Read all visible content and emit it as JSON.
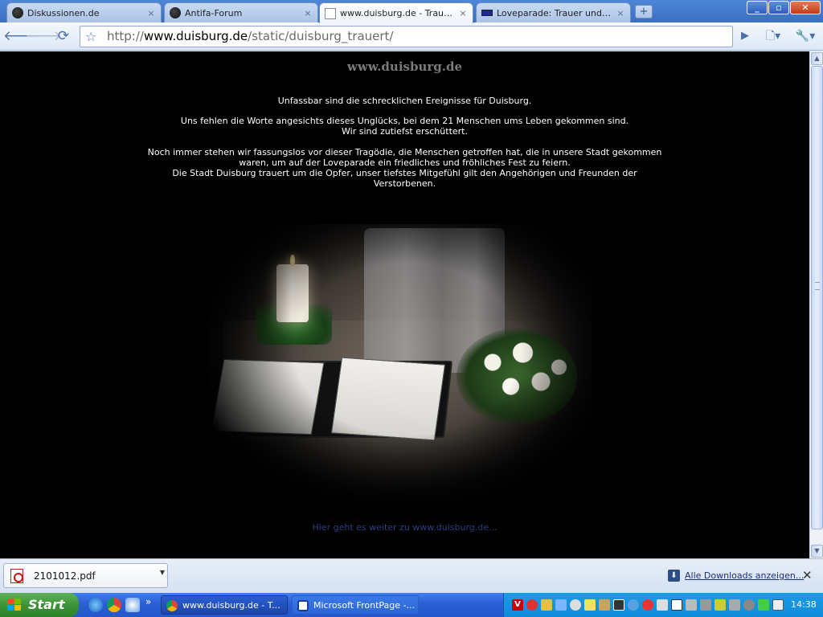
{
  "browser": {
    "tabs": [
      {
        "title": "Diskussionen.de",
        "icon": "bird-icon"
      },
      {
        "title": "Antifa-Forum",
        "icon": "bird-icon"
      },
      {
        "title": "www.duisburg.de - Trauer ...",
        "icon": "page-icon",
        "active": true
      },
      {
        "title": "Loveparade: Trauer und V...",
        "icon": "flag-icon"
      }
    ],
    "close_glyph": "×",
    "new_tab_glyph": "+",
    "url": {
      "scheme": "http://",
      "host": "www.duisburg.de",
      "path": "/static/duisburg_trauert/"
    }
  },
  "page": {
    "site_title": "www.duisburg.de",
    "message": {
      "line1": "Unfassbar sind die schrecklichen Ereignisse für Duisburg.",
      "line2": "Uns fehlen die Worte angesichts dieses Unglücks, bei dem 21 Menschen ums Leben gekommen sind.",
      "line3": "Wir sind zutiefst erschüttert.",
      "line4": "Noch immer stehen wir fassungslos vor dieser Tragödie, die Menschen getroffen hat, die in unsere Stadt gekommen waren, um auf der Loveparade ein friedliches und fröhliches Fest zu feiern.",
      "line5": "Die Stadt Duisburg trauert um die Opfer, unser tiefstes Mitgefühl gilt den Angehörigen und Freunden der Verstorbenen."
    },
    "continue_link": "Hier geht es weiter zu www.duisburg.de..."
  },
  "downloads": {
    "file_name": "2101012.pdf",
    "show_all": "Alle Downloads anzeigen..."
  },
  "taskbar": {
    "start_label": "Start",
    "overflow_glyph": "»",
    "tasks": [
      {
        "label": "www.duisburg.de - T...",
        "icon": "chrome-icon"
      },
      {
        "label": "Microsoft FrontPage -...",
        "icon": "frontpage-icon"
      }
    ],
    "clock": "14:38"
  },
  "colors": {
    "page_background": "#000000",
    "site_title": "#7b7b7b",
    "message_text": "#ffffff",
    "link": "#2c3f83",
    "taskbar": "#2457cc",
    "start_button": "#3a9437"
  }
}
